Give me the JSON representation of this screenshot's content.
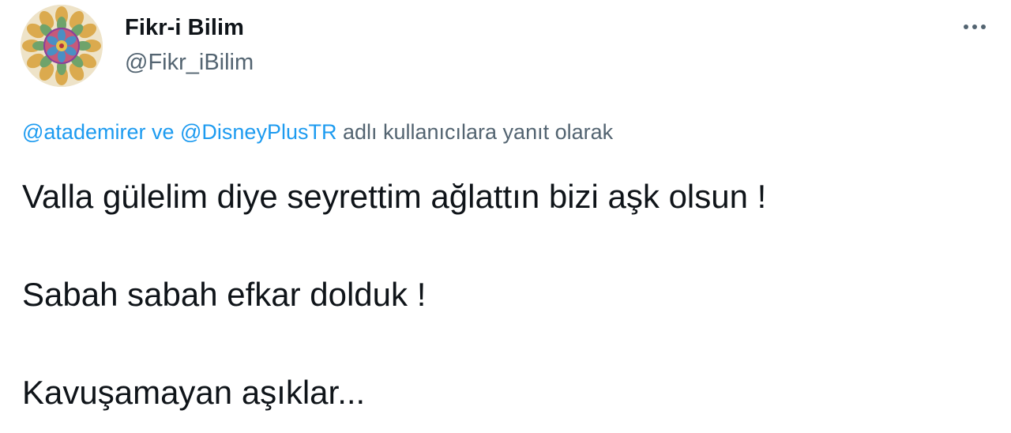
{
  "tweet": {
    "author": {
      "display_name": "Fikr-i Bilim",
      "handle": "@Fikr_iBilim",
      "avatar_icon": "mandala-avatar"
    },
    "more_icon": "more-horizontal-icon",
    "reply_context": {
      "mention_1": "@atademirer",
      "joiner": " ve ",
      "mention_2": "@DisneyPlusTR",
      "suffix": " adlı kullanıcılara yanıt olarak"
    },
    "paragraphs": [
      "Valla gülelim diye seyrettim ağlattın bizi aşk olsun !",
      "Sabah sabah efkar dolduk !",
      "Kavuşamayan aşıklar..."
    ],
    "colors": {
      "link": "#1d9bf0",
      "secondary_text": "#536471",
      "primary_text": "#0f1419"
    }
  }
}
